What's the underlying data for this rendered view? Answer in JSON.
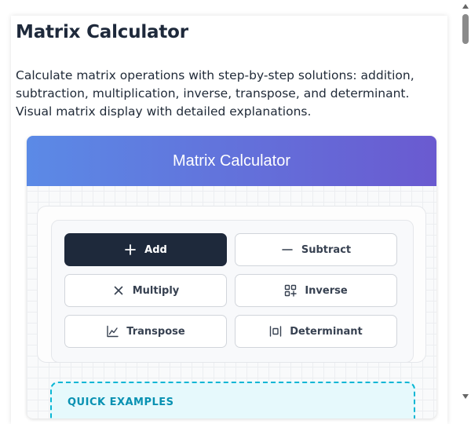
{
  "page": {
    "title": "Matrix Calculator",
    "description": "Calculate matrix operations with step-by-step solutions: addition, subtraction, multiplication, inverse, transpose, and determinant. Visual matrix display with detailed explanations."
  },
  "widget": {
    "header_title": "Matrix Calculator",
    "header_gradient": [
      "#5b8ae6",
      "#6a5ad0"
    ],
    "operations": [
      {
        "label": "Add",
        "icon": "plus-icon",
        "active": true
      },
      {
        "label": "Subtract",
        "icon": "minus-icon",
        "active": false
      },
      {
        "label": "Multiply",
        "icon": "multiply-icon",
        "active": false
      },
      {
        "label": "Inverse",
        "icon": "inverse-icon",
        "active": false
      },
      {
        "label": "Transpose",
        "icon": "transpose-icon",
        "active": false
      },
      {
        "label": "Determinant",
        "icon": "determinant-icon",
        "active": false
      }
    ],
    "examples": {
      "title": "QUICK EXAMPLES",
      "accent": "#06b6d4"
    }
  },
  "colors": {
    "active_button": "#1e293b",
    "text": "#1f2937"
  }
}
